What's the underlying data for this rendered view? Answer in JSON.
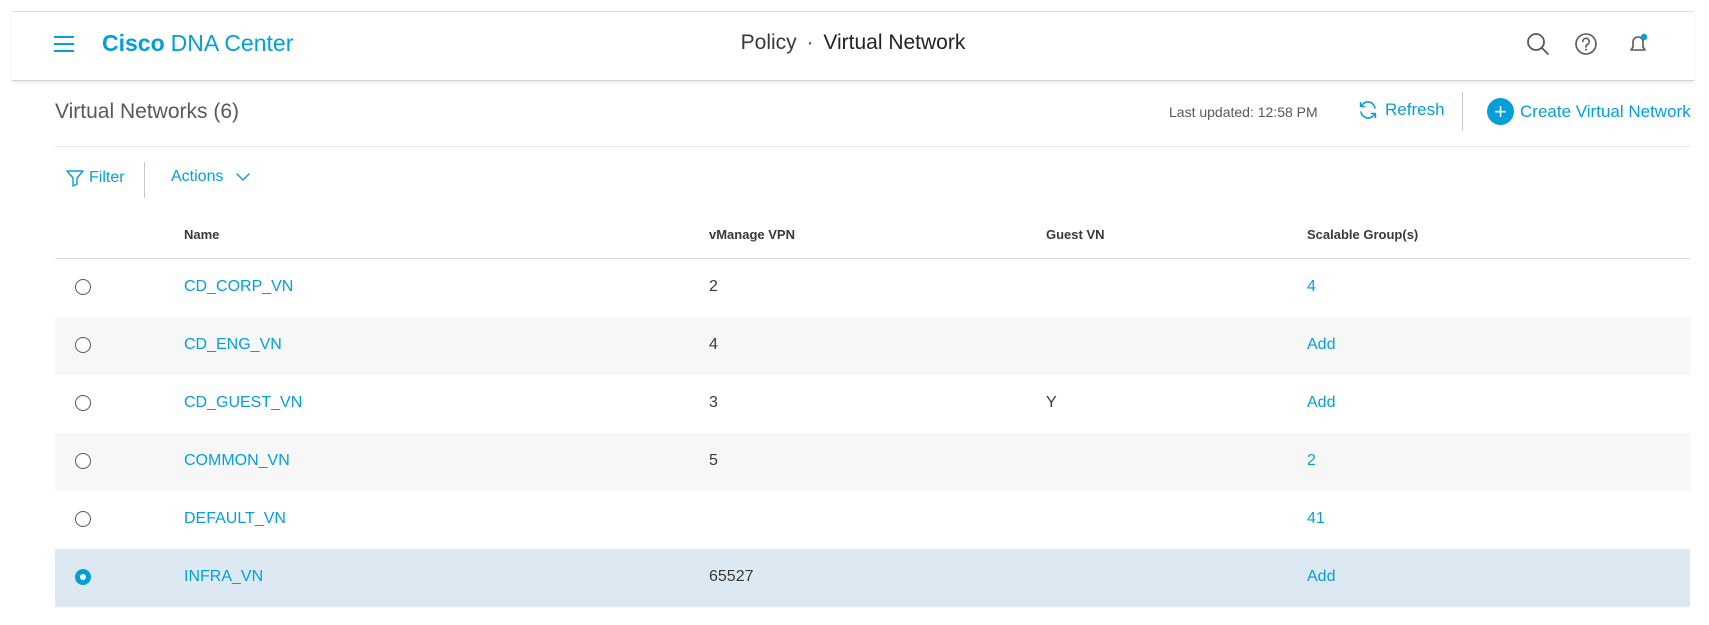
{
  "header": {
    "brand_bold": "Cisco",
    "brand_rest": "DNA Center",
    "breadcrumb_parent": "Policy",
    "breadcrumb_sep": "·",
    "breadcrumb_current": "Virtual Network",
    "icons": [
      "menu-icon",
      "search-icon",
      "help-icon",
      "notifications-icon"
    ]
  },
  "vn_header": {
    "title": "Virtual Networks (6)",
    "last_updated": "Last updated: 12:58 PM",
    "refresh_label": "Refresh",
    "create_label": "Create Virtual Network"
  },
  "toolbar": {
    "filter_label": "Filter",
    "actions_label": "Actions"
  },
  "table": {
    "columns": [
      "Name",
      "vManage VPN",
      "Guest VN",
      "Scalable Group(s)"
    ],
    "rows": [
      {
        "name": "CD_CORP_VN",
        "vpn": "2",
        "guest": "",
        "groups": "4",
        "selected": false
      },
      {
        "name": "CD_ENG_VN",
        "vpn": "4",
        "guest": "",
        "groups": "Add",
        "selected": false
      },
      {
        "name": "CD_GUEST_VN",
        "vpn": "3",
        "guest": "Y",
        "groups": "Add",
        "selected": false
      },
      {
        "name": "COMMON_VN",
        "vpn": "5",
        "guest": "",
        "groups": "2",
        "selected": false
      },
      {
        "name": "DEFAULT_VN",
        "vpn": "",
        "guest": "",
        "groups": "41",
        "selected": false
      },
      {
        "name": "INFRA_VN",
        "vpn": "65527",
        "guest": "",
        "groups": "Add",
        "selected": true
      }
    ]
  },
  "colors": {
    "accent": "#049fd9",
    "selected_row": "#dce9f2",
    "alt_row": "#f7f7f7",
    "text": "#39393b"
  }
}
